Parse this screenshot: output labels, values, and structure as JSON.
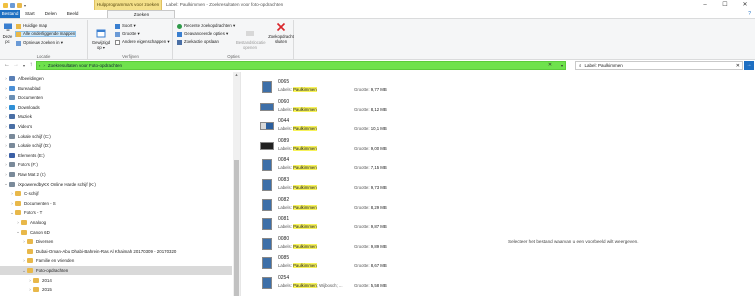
{
  "window": {
    "context_tab_title": "Hulpprogramma's voor zoeken",
    "title": "Label: Paulkimmen - Zoekresultaten voor foto-opdrachten",
    "controls": [
      "–",
      "☐",
      "✕"
    ]
  },
  "tabs": [
    "Bestand",
    "Start",
    "Delen",
    "Beeld",
    "Zoeken"
  ],
  "ribbon": {
    "locatie": {
      "label": "Locatie",
      "deze_pc": "Deze pc",
      "huidige_map": "Huidige map",
      "alle_submappen": "Alle onderliggende mappen",
      "opnieuw_zoeken": "Opnieuw zoeken in ▾"
    },
    "verfijnen": {
      "label": "Verfijnen",
      "gewijzigd_op": "Gewijzigd op ▾",
      "soort": "Soort ▾",
      "grootte": "Grootte ▾",
      "andere": "Andere eigenschappen ▾"
    },
    "opties": {
      "label": "Opties",
      "recente": "Recente zoekopdrachten ▾",
      "geavanceerde": "Geavanceerde opties ▾",
      "zoekactie_opslaan": "Zoekactie opslaan",
      "bestandslocatie": "Bestandslocatie openen",
      "zoekopdracht_sluiten": "Zoekopdracht sluiten"
    }
  },
  "address": {
    "path": "Zoekresultaten voor Foto-opdrachten",
    "search_value": "Label: Paulkimmen"
  },
  "nav_items": [
    {
      "label": "Afbeeldingen",
      "chev": ">",
      "color": "#5a7fb5",
      "indent": 0
    },
    {
      "label": "Bureaublad",
      "chev": ">",
      "color": "#4a8fd6",
      "indent": 0
    },
    {
      "label": "Documenten",
      "chev": ">",
      "color": "#6a8fb5",
      "indent": 0
    },
    {
      "label": "Downloads",
      "chev": ">",
      "color": "#2f8fd6",
      "indent": 0
    },
    {
      "label": "Muziek",
      "chev": ">",
      "color": "#4a6fa5",
      "indent": 0
    },
    {
      "label": "Video's",
      "chev": ">",
      "color": "#4a6fa5",
      "indent": 0
    },
    {
      "label": "Lokale schijf (C:)",
      "chev": ">",
      "color": "#7a8a9a",
      "indent": 0
    },
    {
      "label": "Lokale schijf (D:)",
      "chev": ">",
      "color": "#7a8a9a",
      "indent": 0
    },
    {
      "label": "Elements (E:)",
      "chev": ">",
      "color": "#3a5fa5",
      "indent": 0
    },
    {
      "label": "Foto's (F:)",
      "chev": ">",
      "color": "#7a8a9a",
      "indent": 0
    },
    {
      "label": "Raw Mat 2 (I:)",
      "chev": ">",
      "color": "#7a8a9a",
      "indent": 0
    },
    {
      "label": "iXpoweredbyKX Online Harde schijf (K:)",
      "chev": "v",
      "color": "#7a8a9a",
      "indent": 0
    },
    {
      "label": "C-schijf",
      "chev": ">",
      "color": "#e8b84a",
      "indent": 1
    },
    {
      "label": "Documenten - S",
      "chev": ">",
      "color": "#e8b84a",
      "indent": 1
    },
    {
      "label": "Foto's - T",
      "chev": "v",
      "color": "#e8b84a",
      "indent": 1
    },
    {
      "label": "Analoog",
      "chev": ">",
      "color": "#e8b84a",
      "indent": 2
    },
    {
      "label": "Canon 6D",
      "chev": "v",
      "color": "#e8b84a",
      "indent": 2
    },
    {
      "label": "Diversen",
      "chev": ">",
      "color": "#e8b84a",
      "indent": 3
    },
    {
      "label": "Dubai-Oman-Abu Dhabi-Bahrein-Ras Al Khaimah 20170309 - 20170320",
      "chev": "",
      "color": "#e8b84a",
      "indent": 3
    },
    {
      "label": "Familie en vrienden",
      "chev": ">",
      "color": "#e8b84a",
      "indent": 3
    },
    {
      "label": "Foto-opdrachten",
      "chev": "v",
      "color": "#e8b84a",
      "indent": 3,
      "selected": true
    },
    {
      "label": "2014",
      "chev": ">",
      "color": "#e8b84a",
      "indent": 4
    },
    {
      "label": "2015",
      "chev": ">",
      "color": "#e8b84a",
      "indent": 4
    }
  ],
  "results": [
    {
      "name": "0065",
      "label_prefix": "Labels: ",
      "label": "Paulkimmen",
      "size_label": "Grootte:",
      "size": "9,77 MB",
      "thumb": "tall"
    },
    {
      "name": "0060",
      "label_prefix": "Labels: ",
      "label": "Paulkimmen",
      "size_label": "Grootte:",
      "size": "8,12 MB",
      "thumb": "wide"
    },
    {
      "name": "0044",
      "label_prefix": "Labels: ",
      "label": "Paulkimmen",
      "size_label": "Grootte:",
      "size": "10,1 MB",
      "thumb": "mix"
    },
    {
      "name": "0089",
      "label_prefix": "Labels: ",
      "label": "Paulkimmen",
      "size_label": "Grootte:",
      "size": "9,00 MB",
      "thumb": "dark"
    },
    {
      "name": "0084",
      "label_prefix": "Labels: ",
      "label": "Paulkimmen",
      "size_label": "Grootte:",
      "size": "7,15 MB",
      "thumb": "tall"
    },
    {
      "name": "0083",
      "label_prefix": "Labels: ",
      "label": "Paulkimmen",
      "size_label": "Grootte:",
      "size": "9,73 MB",
      "thumb": "tall"
    },
    {
      "name": "0082",
      "label_prefix": "Labels: ",
      "label": "Paulkimmen",
      "size_label": "Grootte:",
      "size": "8,29 MB",
      "thumb": "tall"
    },
    {
      "name": "0081",
      "label_prefix": "Labels: ",
      "label": "Paulkimmen",
      "size_label": "Grootte:",
      "size": "9,87 MB",
      "thumb": "tall"
    },
    {
      "name": "0080",
      "label_prefix": "Labels: ",
      "label": "Paulkimmen",
      "size_label": "Grootte:",
      "size": "9,89 MB",
      "thumb": "tall"
    },
    {
      "name": "0085",
      "label_prefix": "Labels: ",
      "label": "Paulkimmen",
      "size_label": "Grootte:",
      "size": "8,67 MB",
      "thumb": "tall"
    },
    {
      "name": "0254",
      "label_prefix": "Labels: ",
      "label": "Paulkimmen",
      "label_suffix": "; Wijbosch; ...",
      "size_label": "Grootte:",
      "size": "5,58 MB",
      "thumb": "tall"
    }
  ],
  "preview": {
    "message": "Selecteer het bestand waarvan u een voorbeeld wilt weergeven."
  },
  "colors": {
    "accent": "#1e6fc2",
    "address_green": "#6fe24c",
    "highlight_yellow": "#f7f35a",
    "context_tab": "#f4e08a"
  }
}
